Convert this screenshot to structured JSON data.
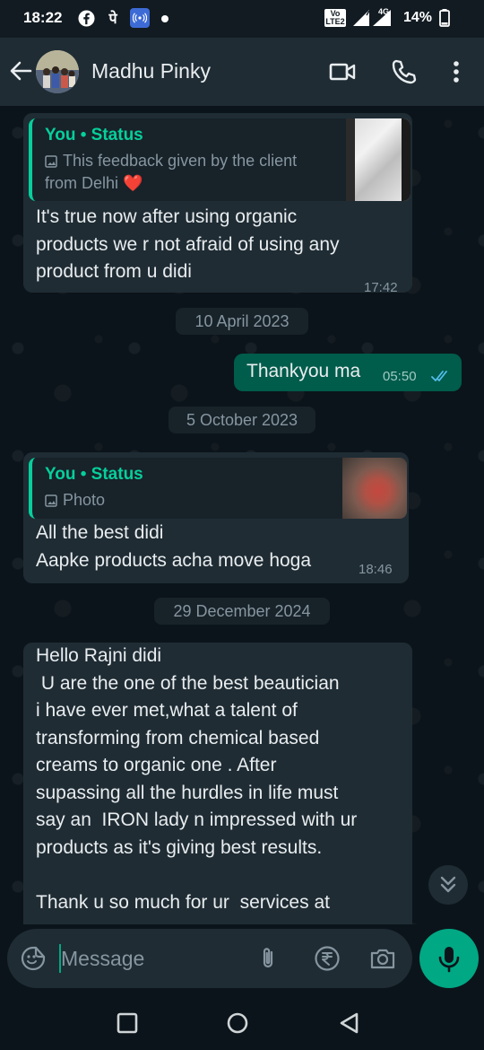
{
  "status_bar": {
    "time": "18:22",
    "carrier_glyph": "पे",
    "lte_label": "Vo LTE2",
    "network_label": "4G",
    "battery": "14%",
    "icons": [
      "facebook-icon",
      "phonepe-icon",
      "hotspot-icon",
      "notification-dot",
      "volte-icon",
      "signal-icon",
      "battery-icon"
    ]
  },
  "header": {
    "contact_name": "Madhu Pinky",
    "icons": [
      "back-arrow-icon",
      "avatar",
      "video-call-icon",
      "voice-call-icon",
      "more-options-icon"
    ]
  },
  "messages": [
    {
      "direction": "in",
      "quote_author": "You • Status",
      "quote_text_line1": "This feedback given by the client",
      "quote_text_line2": "from Delhi",
      "quote_emoji": "❤️",
      "text": "It's true now after using organic\nproducts we r not afraid of using any\nproduct from u didi",
      "time": "17:42"
    },
    {
      "type": "date",
      "label": "10 April 2023"
    },
    {
      "direction": "out",
      "text": "Thankyou ma",
      "time": "05:50",
      "read": true
    },
    {
      "type": "date",
      "label": "5 October 2023"
    },
    {
      "direction": "in",
      "quote_author": "You • Status",
      "quote_text_line1": "Photo",
      "text": "All the best didi\nAapke products acha move hoga",
      "time": "18:46"
    },
    {
      "type": "date",
      "label": "29 December 2024"
    },
    {
      "direction": "in",
      "text": "Hello Rajni didi\n U are the one of the best beautician\ni have ever met,what a talent of\ntransforming from chemical based\ncreams to organic one . After\nsupassing all the hurdles in life must\nsay an  IRON lady n impressed with ur\nproducts as it's giving best results.\n\nThank u so much for ur  services at"
    }
  ],
  "composer": {
    "placeholder": "Message",
    "icons": [
      "emoji-icon",
      "attach-icon",
      "rupee-payment-icon",
      "camera-icon",
      "mic-icon"
    ]
  },
  "scroll_down": {
    "icon": "double-chevron-down-icon"
  },
  "nav_bar": {
    "icons": [
      "recents-square-icon",
      "home-circle-icon",
      "back-triangle-icon"
    ]
  },
  "colors": {
    "app_bg": "#0b141a",
    "header_bg": "#1f2c34",
    "incoming_bubble": "#1f2c34",
    "outgoing_bubble": "#005c4b",
    "accent_green": "#06cf9c",
    "mic_green": "#00a884",
    "read_ticks": "#53bdeb",
    "secondary_text": "#8696a0"
  }
}
